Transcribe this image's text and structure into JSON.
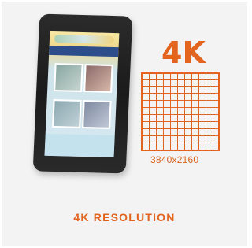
{
  "card": {
    "badge": "4K",
    "resolution": "3840x2160",
    "title": "4K RESOLUTION"
  },
  "colors": {
    "accent": "#e3641f",
    "background": "#f3f3f3"
  }
}
